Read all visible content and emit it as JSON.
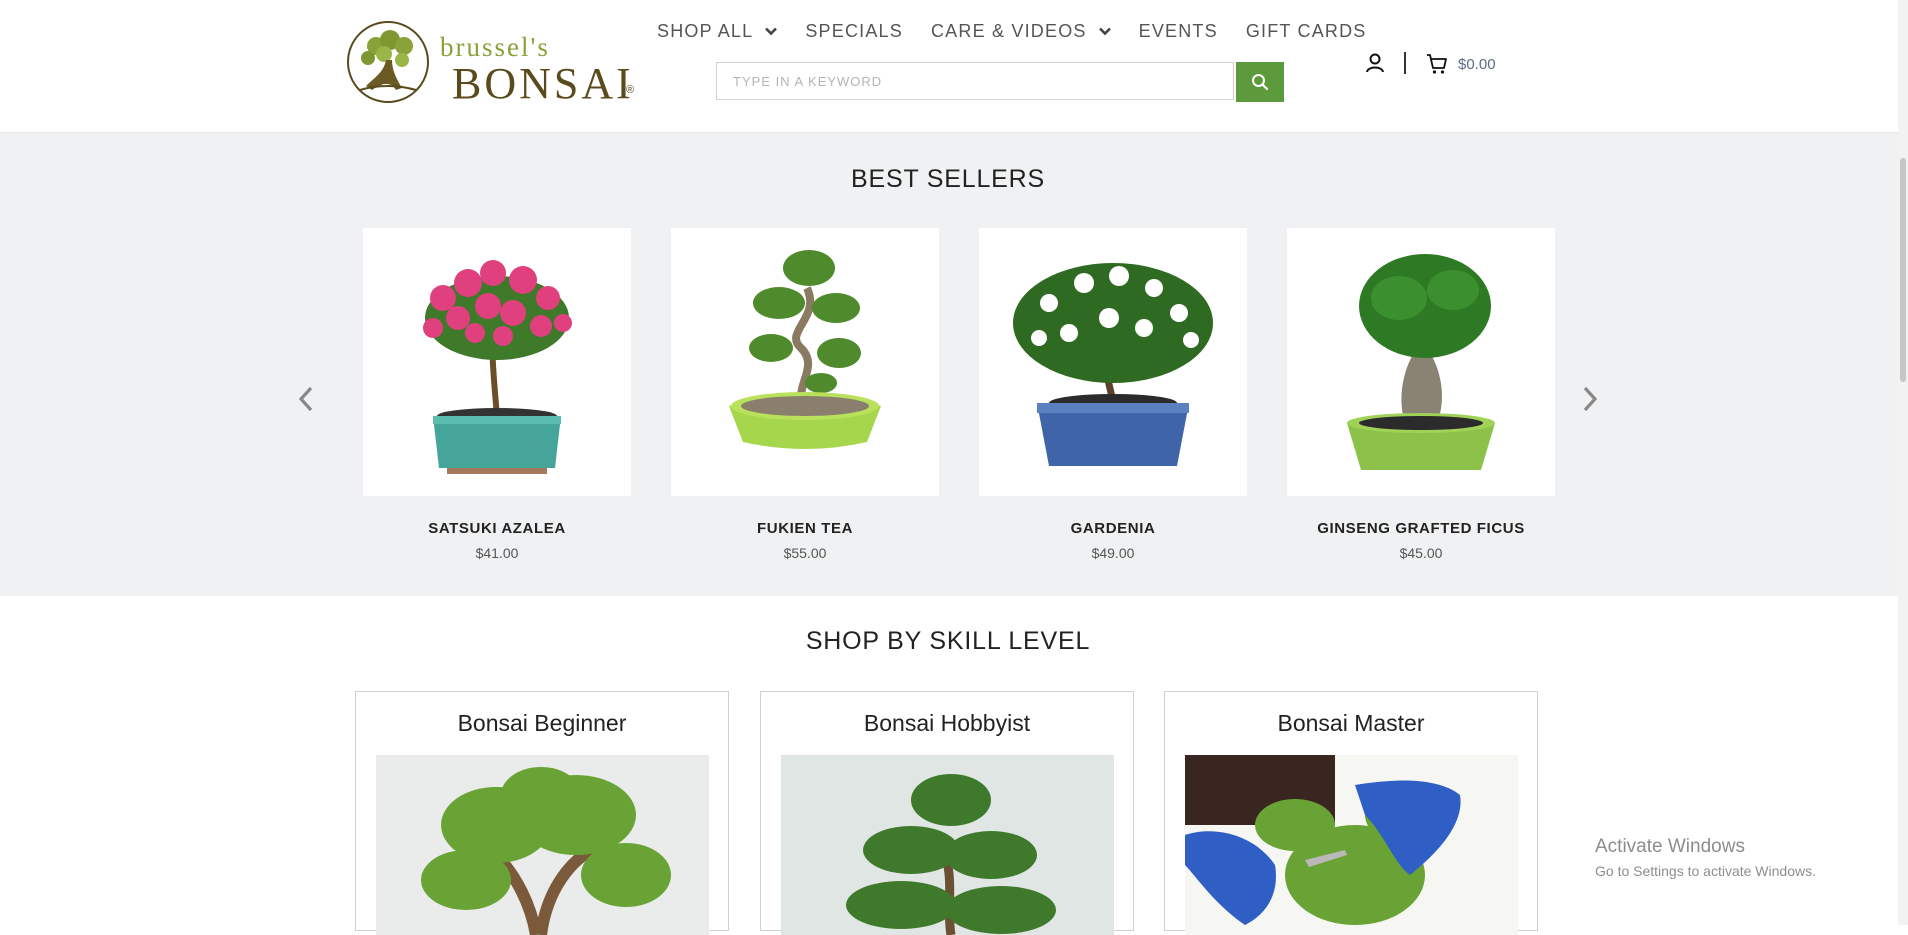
{
  "brand": {
    "name_small": "brussel's",
    "name_big": "BONSAI",
    "registered_mark": "®"
  },
  "nav": {
    "items": [
      {
        "label": "SHOP ALL",
        "has_dropdown": true
      },
      {
        "label": "SPECIALS",
        "has_dropdown": false
      },
      {
        "label": "CARE & VIDEOS",
        "has_dropdown": true
      },
      {
        "label": "EVENTS",
        "has_dropdown": false
      },
      {
        "label": "GIFT CARDS",
        "has_dropdown": false
      }
    ]
  },
  "search": {
    "placeholder": "TYPE IN A KEYWORD",
    "value": "",
    "button_icon": "search-icon"
  },
  "account": {
    "icon": "user-icon"
  },
  "cart": {
    "icon": "cart-icon",
    "total": "$0.00"
  },
  "best_sellers": {
    "title": "BEST SELLERS",
    "prev_icon": "chevron-left-icon",
    "next_icon": "chevron-right-icon",
    "products": [
      {
        "name": "SATSUKI AZALEA",
        "price": "$41.00"
      },
      {
        "name": "FUKIEN TEA",
        "price": "$55.00"
      },
      {
        "name": "GARDENIA",
        "price": "$49.00"
      },
      {
        "name": "GINSENG GRAFTED FICUS",
        "price": "$45.00"
      }
    ]
  },
  "skill_level": {
    "title": "SHOP BY SKILL LEVEL",
    "cards": [
      {
        "title": "Bonsai Beginner"
      },
      {
        "title": "Bonsai Hobbyist"
      },
      {
        "title": "Bonsai Master"
      }
    ]
  },
  "system_watermark": {
    "title": "Activate Windows",
    "subtitle": "Go to Settings to activate Windows."
  },
  "colors": {
    "accent_green": "#5c9a3c",
    "logo_olive": "#8aa23a",
    "logo_brown": "#5a4a1c",
    "section_background": "#f0f1f2"
  }
}
